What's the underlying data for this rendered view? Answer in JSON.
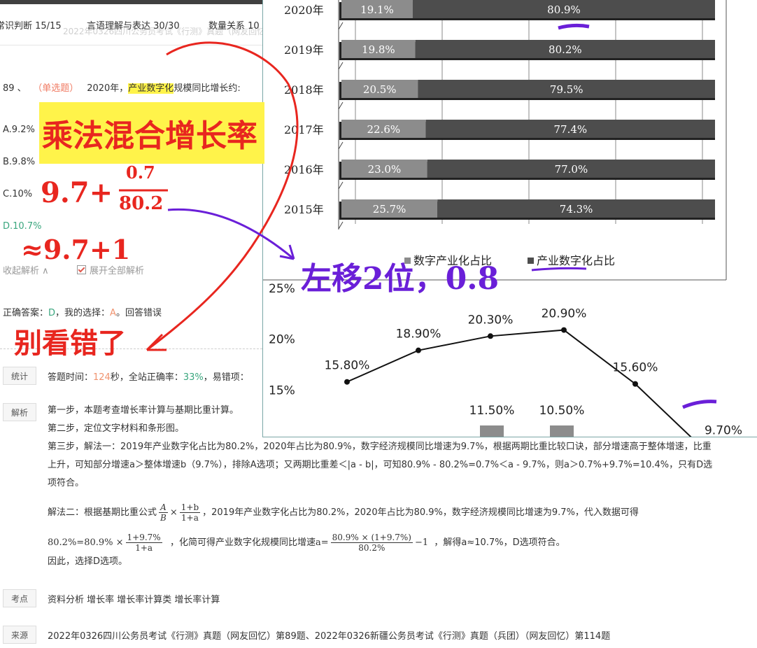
{
  "tabs": [
    "常识判断 15/15",
    "言语理解与表达 30/30",
    "数量关系 10"
  ],
  "ghost_title": "2022年0326四川公务员考试《行测》真题（网友回忆）",
  "question": {
    "number": "89 、",
    "type": "（单选题）",
    "text_pre": "2020年，",
    "text_highlight": "产业数字化",
    "text_post": "规模同比增长约:",
    "options": [
      "A.9.2%",
      "B.9.8%",
      "C.10%",
      "D.10.7%"
    ]
  },
  "controls": {
    "collapse": "收起解析 ∧",
    "expand_all": "展开全部解析"
  },
  "answer": {
    "prefix": "正确答案：",
    "correct": "D",
    "mid": "，我的选择：",
    "mine": "A",
    "suffix": "。回答错误"
  },
  "stats": {
    "label": "统计",
    "time_prefix": "答题时间：",
    "time": "124",
    "time_unit": "秒，全站正确率：",
    "rate": "33%",
    "tail": "，易错项："
  },
  "analysis": {
    "label": "解析",
    "step1": "第一步，本题考查增长率计算与基期比重计算。",
    "step2": "第二步，定位文字材料和条形图。",
    "step3": "第三步，解法一：2019年产业数字化占比为80.2%，2020年占比为80.9%，数字经济规模同比增速为9.7%，根据两期比重比较口诀，部分增速高于整体增速，比重上升，可知部分增速a＞整体增速b（9.7%），排除A选项；又两期比重差＜|a - b|，可知80.9% - 80.2%=0.7%＜a - 9.7%，则a＞0.7%+9.7%=10.4%，只有D选项符合。",
    "m2_a": "解法二：根据基期比重公式",
    "m2_frac1_n": "A",
    "m2_frac1_d": "B",
    "m2_times": "×",
    "m2_frac2_n": "1+b",
    "m2_frac2_d": "1+a",
    "m2_b": "，2019年产业数字化占比为80.2%，2020年占比为80.9%，数字经济规模同比增速为9.7%，代入数据可得",
    "m2_eq_left": "80.2%=80.9% ×",
    "m2_frac3_n": "1+9.7%",
    "m2_frac3_d": "1+a",
    "m2_c": "，化简可得产业数字化规模同比增速",
    "m2_a_eq": "a=",
    "m2_frac4_n": "80.9% × (1+9.7%)",
    "m2_frac4_d": "80.2%",
    "m2_minus": "−1",
    "m2_d": "，解得a≈10.7%，D选项符合。",
    "conclusion": "因此，选择D选项。"
  },
  "points": {
    "label": "考点",
    "text": "资料分析  增长率  增长率计算类 增长率计算"
  },
  "source": {
    "label": "来源",
    "text": "2022年0326四川公务员考试《行测》真题（网友回忆）第89题、2022年0326新疆公务员考试《行测》真题（兵团）（网友回忆）第114题"
  },
  "handwriting": {
    "note1": "乘法混合增长率",
    "note2": "9.7+",
    "note2_num": "0.7",
    "note2_den": "80.2",
    "note3": "≈9.7+1",
    "note4": "别看错了",
    "note5": "左移2位，0.8"
  },
  "colors": {
    "red_ink": "#e8261f",
    "purple_ink": "#6a1fd8",
    "highlight": "#fff34a",
    "green": "#3aa67e",
    "orange": "#f0936f"
  },
  "chart_data": [
    {
      "type": "bar",
      "orientation": "horizontal-stacked",
      "categories": [
        "2020年",
        "2019年",
        "2018年",
        "2017年",
        "2016年",
        "2015年"
      ],
      "series": [
        {
          "name": "数字产业化占比",
          "values": [
            19.1,
            19.8,
            20.5,
            22.6,
            23.0,
            25.7
          ],
          "labels": [
            "19.1%",
            "19.8%",
            "20.5%",
            "22.6%",
            "23.0%",
            "25.7%"
          ],
          "color": "#8c8c8c"
        },
        {
          "name": "产业数字化占比",
          "values": [
            80.9,
            80.2,
            79.5,
            77.4,
            77.0,
            74.3
          ],
          "labels": [
            "80.9%",
            "80.2%",
            "79.5%",
            "77.4%",
            "77.0%",
            "74.3%"
          ],
          "color": "#4d4d4d"
        }
      ],
      "legend": [
        "数字产业化占比",
        "产业数字化占比"
      ],
      "legend_position": "bottom"
    },
    {
      "type": "line",
      "yticks": [
        "25%",
        "20%",
        "15%"
      ],
      "ylim": [
        10,
        25
      ],
      "series": [
        {
          "values": [
            15.8,
            18.9,
            20.3,
            20.9,
            15.6,
            9.7
          ],
          "labels": [
            "15.80%",
            "18.90%",
            "20.30%",
            "20.90%",
            "15.60%",
            "9.70%"
          ]
        }
      ],
      "bars": {
        "values": [
          11.5,
          10.5
        ],
        "labels": [
          "11.50%",
          "10.50%"
        ]
      }
    }
  ]
}
